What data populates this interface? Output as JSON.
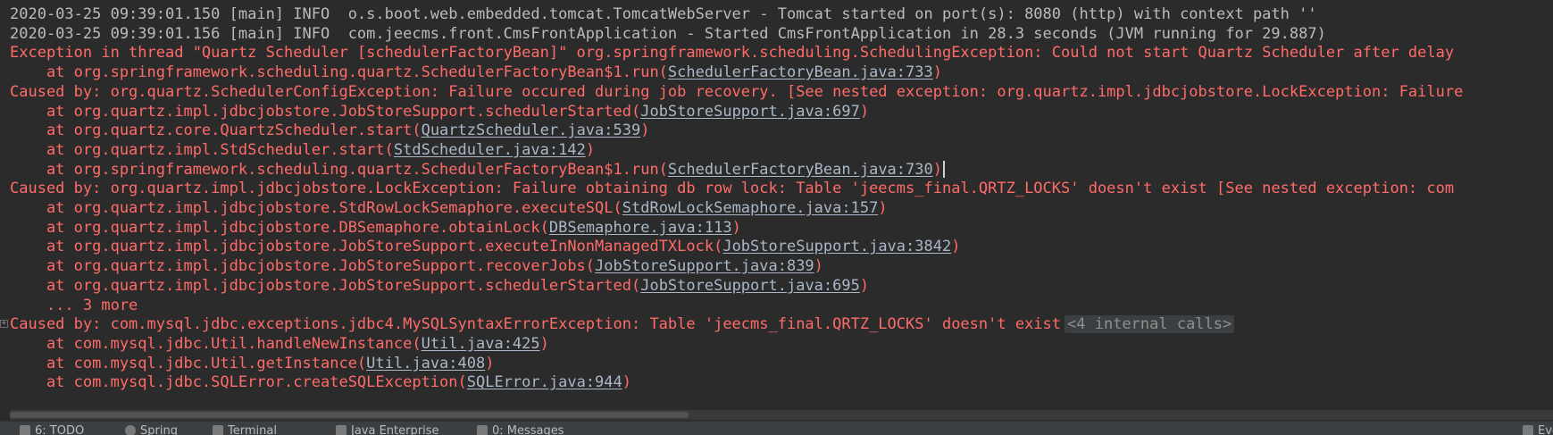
{
  "console": {
    "lines": [
      {
        "kind": "info",
        "text": "2020-03-25 09:39:01.150 [main] INFO  o.s.boot.web.embedded.tomcat.TomcatWebServer - Tomcat started on port(s): 8080 (http) with context path ''"
      },
      {
        "kind": "info",
        "text": "2020-03-25 09:39:01.156 [main] INFO  com.jeecms.front.CmsFrontApplication - Started CmsFrontApplication in 28.3 seconds (JVM running for 29.887)"
      },
      {
        "kind": "err",
        "text": "Exception in thread \"Quartz Scheduler [schedulerFactoryBean]\" org.springframework.scheduling.SchedulingException: Could not start Quartz Scheduler after delay"
      },
      {
        "kind": "err",
        "prefix": "    at org.springframework.scheduling.quartz.SchedulerFactoryBean$1.run(",
        "link": "SchedulerFactoryBean.java:733",
        "suffix": ")"
      },
      {
        "kind": "err",
        "text": "Caused by: org.quartz.SchedulerConfigException: Failure occured during job recovery. [See nested exception: org.quartz.impl.jdbcjobstore.LockException: Failure"
      },
      {
        "kind": "err",
        "prefix": "    at org.quartz.impl.jdbcjobstore.JobStoreSupport.schedulerStarted(",
        "link": "JobStoreSupport.java:697",
        "suffix": ")"
      },
      {
        "kind": "err",
        "prefix": "    at org.quartz.core.QuartzScheduler.start(",
        "link": "QuartzScheduler.java:539",
        "suffix": ")"
      },
      {
        "kind": "err",
        "prefix": "    at org.quartz.impl.StdScheduler.start(",
        "link": "StdScheduler.java:142",
        "suffix": ")"
      },
      {
        "kind": "err",
        "prefix": "    at org.springframework.scheduling.quartz.SchedulerFactoryBean$1.run(",
        "link": "SchedulerFactoryBean.java:730",
        "suffix": ")"
      },
      {
        "kind": "err",
        "text": "Caused by: org.quartz.impl.jdbcjobstore.LockException: Failure obtaining db row lock: Table 'jeecms_final.QRTZ_LOCKS' doesn't exist [See nested exception: com"
      },
      {
        "kind": "err",
        "prefix": "    at org.quartz.impl.jdbcjobstore.StdRowLockSemaphore.executeSQL(",
        "link": "StdRowLockSemaphore.java:157",
        "suffix": ")"
      },
      {
        "kind": "err",
        "prefix": "    at org.quartz.impl.jdbcjobstore.DBSemaphore.obtainLock(",
        "link": "DBSemaphore.java:113",
        "suffix": ")"
      },
      {
        "kind": "err",
        "prefix": "    at org.quartz.impl.jdbcjobstore.JobStoreSupport.executeInNonManagedTXLock(",
        "link": "JobStoreSupport.java:3842",
        "suffix": ")"
      },
      {
        "kind": "err",
        "prefix": "    at org.quartz.impl.jdbcjobstore.JobStoreSupport.recoverJobs(",
        "link": "JobStoreSupport.java:839",
        "suffix": ")"
      },
      {
        "kind": "err",
        "prefix": "    at org.quartz.impl.jdbcjobstore.JobStoreSupport.schedulerStarted(",
        "link": "JobStoreSupport.java:695",
        "suffix": ")"
      },
      {
        "kind": "err",
        "text": "    ... 3 more"
      },
      {
        "kind": "err",
        "text": "Caused by: com.mysql.jdbc.exceptions.jdbc4.MySQLSyntaxErrorException: Table 'jeecms_final.QRTZ_LOCKS' doesn't exist",
        "internal": "<4 internal calls>"
      },
      {
        "kind": "err",
        "prefix": "    at com.mysql.jdbc.Util.handleNewInstance(",
        "link": "Util.java:425",
        "suffix": ")"
      },
      {
        "kind": "err",
        "prefix": "    at com.mysql.jdbc.Util.getInstance(",
        "link": "Util.java:408",
        "suffix": ")"
      },
      {
        "kind": "err",
        "prefix": "    at com.mysql.jdbc.SQLError.createSQLException(",
        "link": "SQLError.java:944",
        "suffix": ")"
      }
    ]
  },
  "toolwindows": [
    {
      "label": "6: TODO",
      "icon": "todo-icon"
    },
    {
      "label": "Spring",
      "icon": "spring-icon"
    },
    {
      "label": "Terminal",
      "icon": "terminal-icon"
    },
    {
      "label": "Java Enterprise",
      "icon": "java-enterprise-icon"
    },
    {
      "label": "0: Messages",
      "icon": "messages-icon"
    },
    {
      "label": "Event Log",
      "icon": "event-log-icon"
    }
  ],
  "colors": {
    "background": "#2b2b2b",
    "info_text": "#bbbbbb",
    "error_text": "#ff6b68",
    "link_text": "#a9b7c6"
  }
}
